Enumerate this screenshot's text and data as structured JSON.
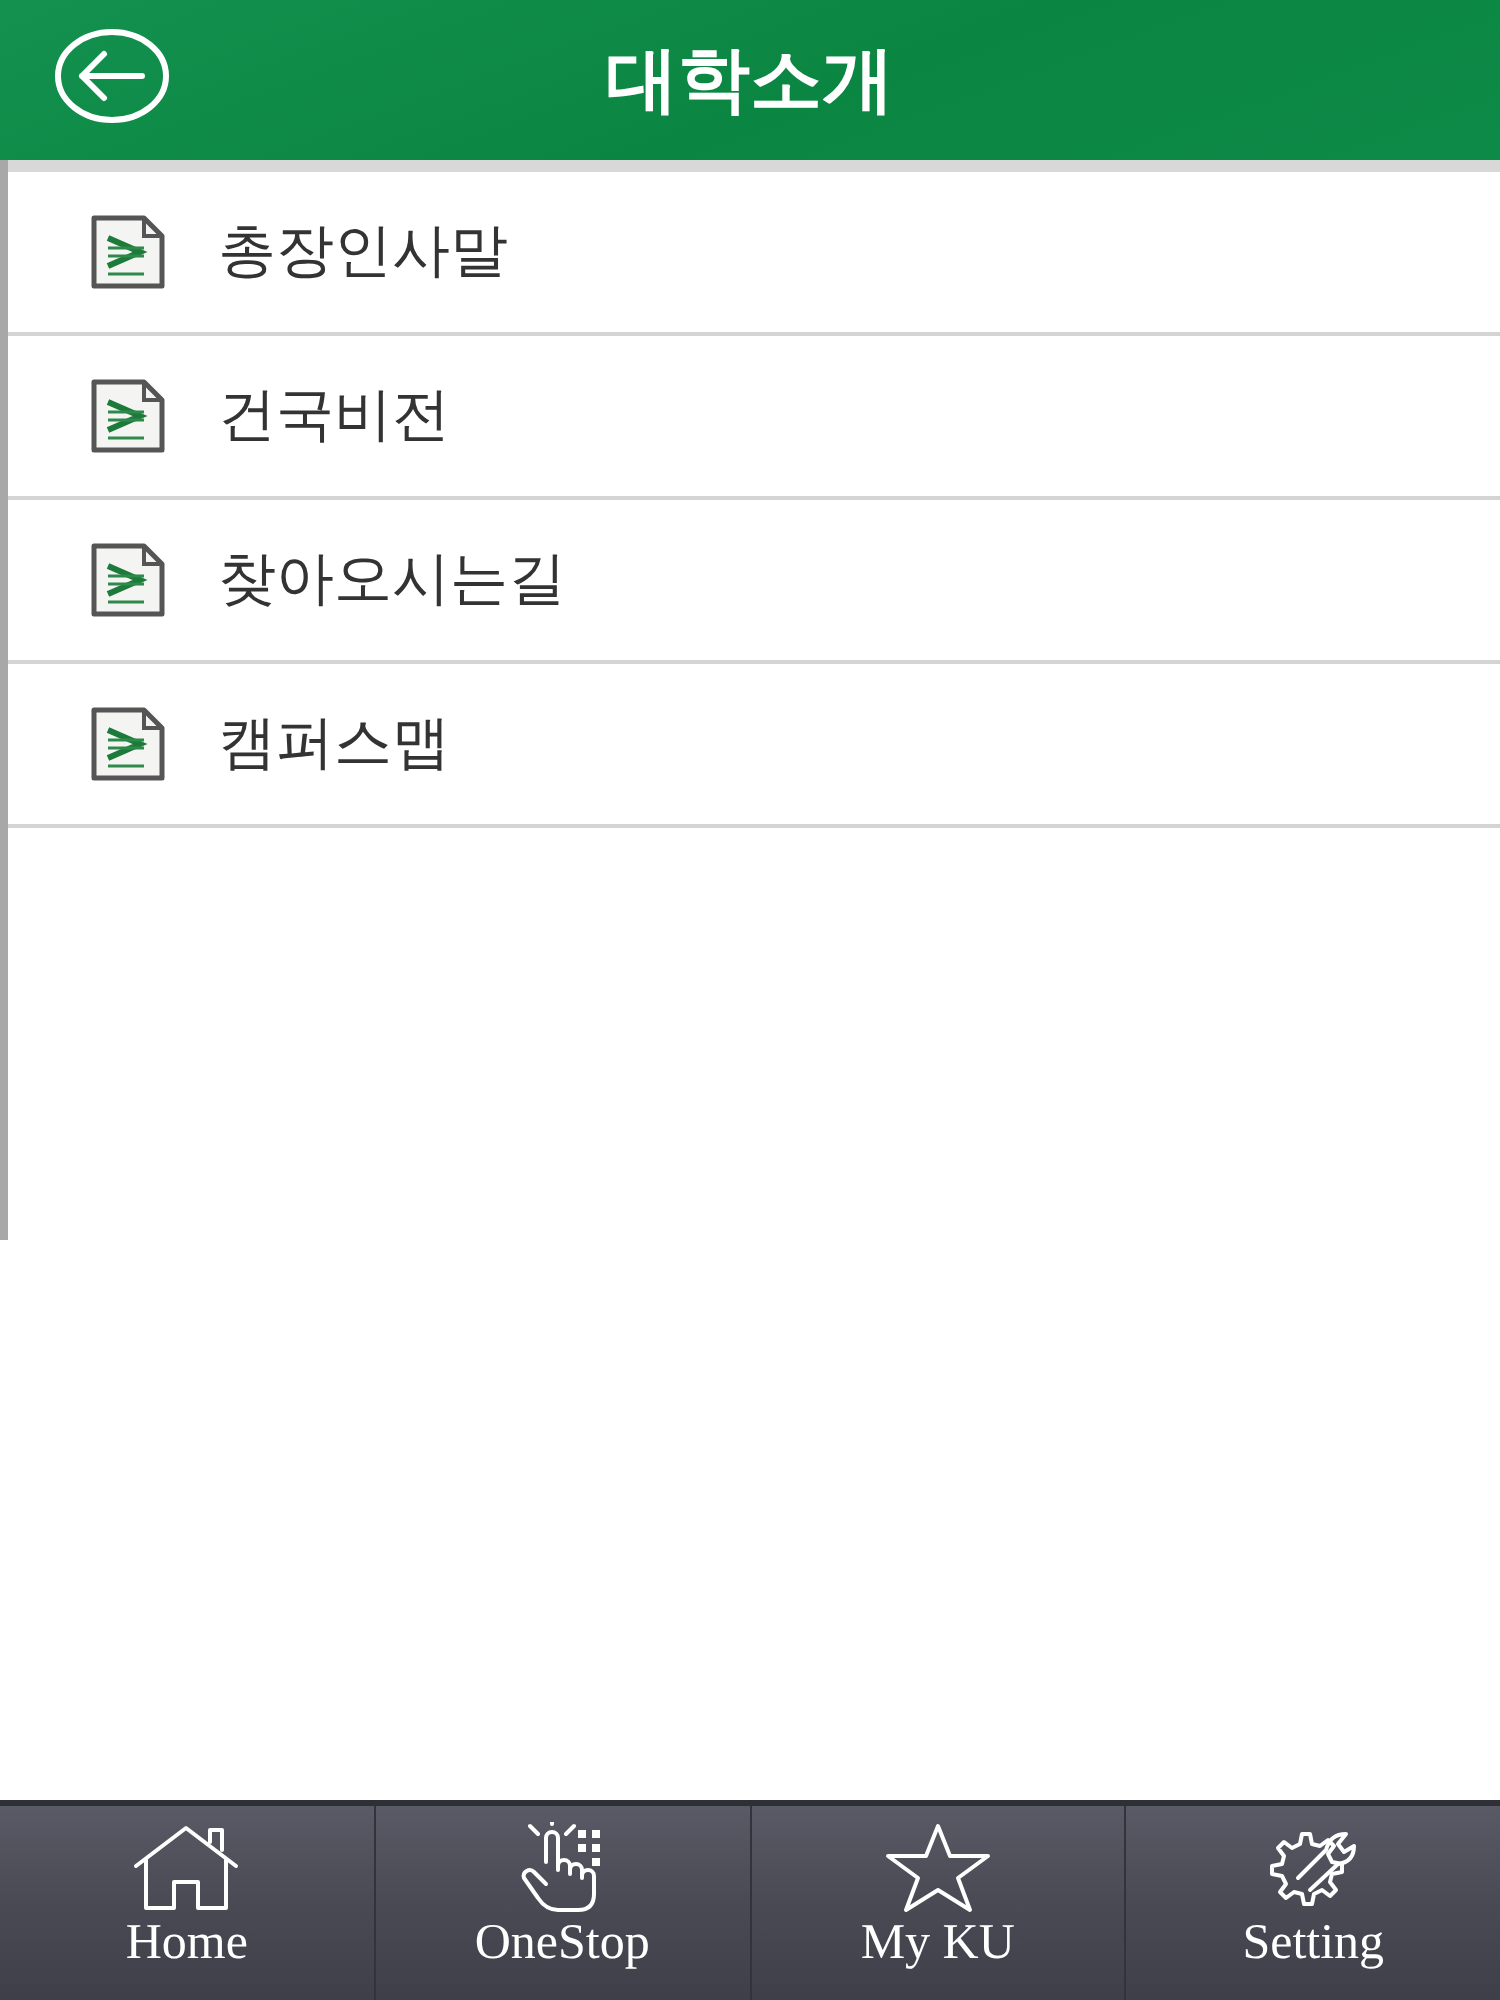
{
  "header": {
    "title": "대학소개"
  },
  "menu": [
    {
      "label": "총장인사말"
    },
    {
      "label": "건국비전"
    },
    {
      "label": "찾아오시는길"
    },
    {
      "label": "캠퍼스맵"
    }
  ],
  "tab_bar": [
    {
      "kind": "home",
      "label": "Home"
    },
    {
      "kind": "onestop",
      "label": "OneStop"
    },
    {
      "kind": "star",
      "label": "My KU"
    },
    {
      "kind": "setting",
      "label": "Setting"
    }
  ]
}
